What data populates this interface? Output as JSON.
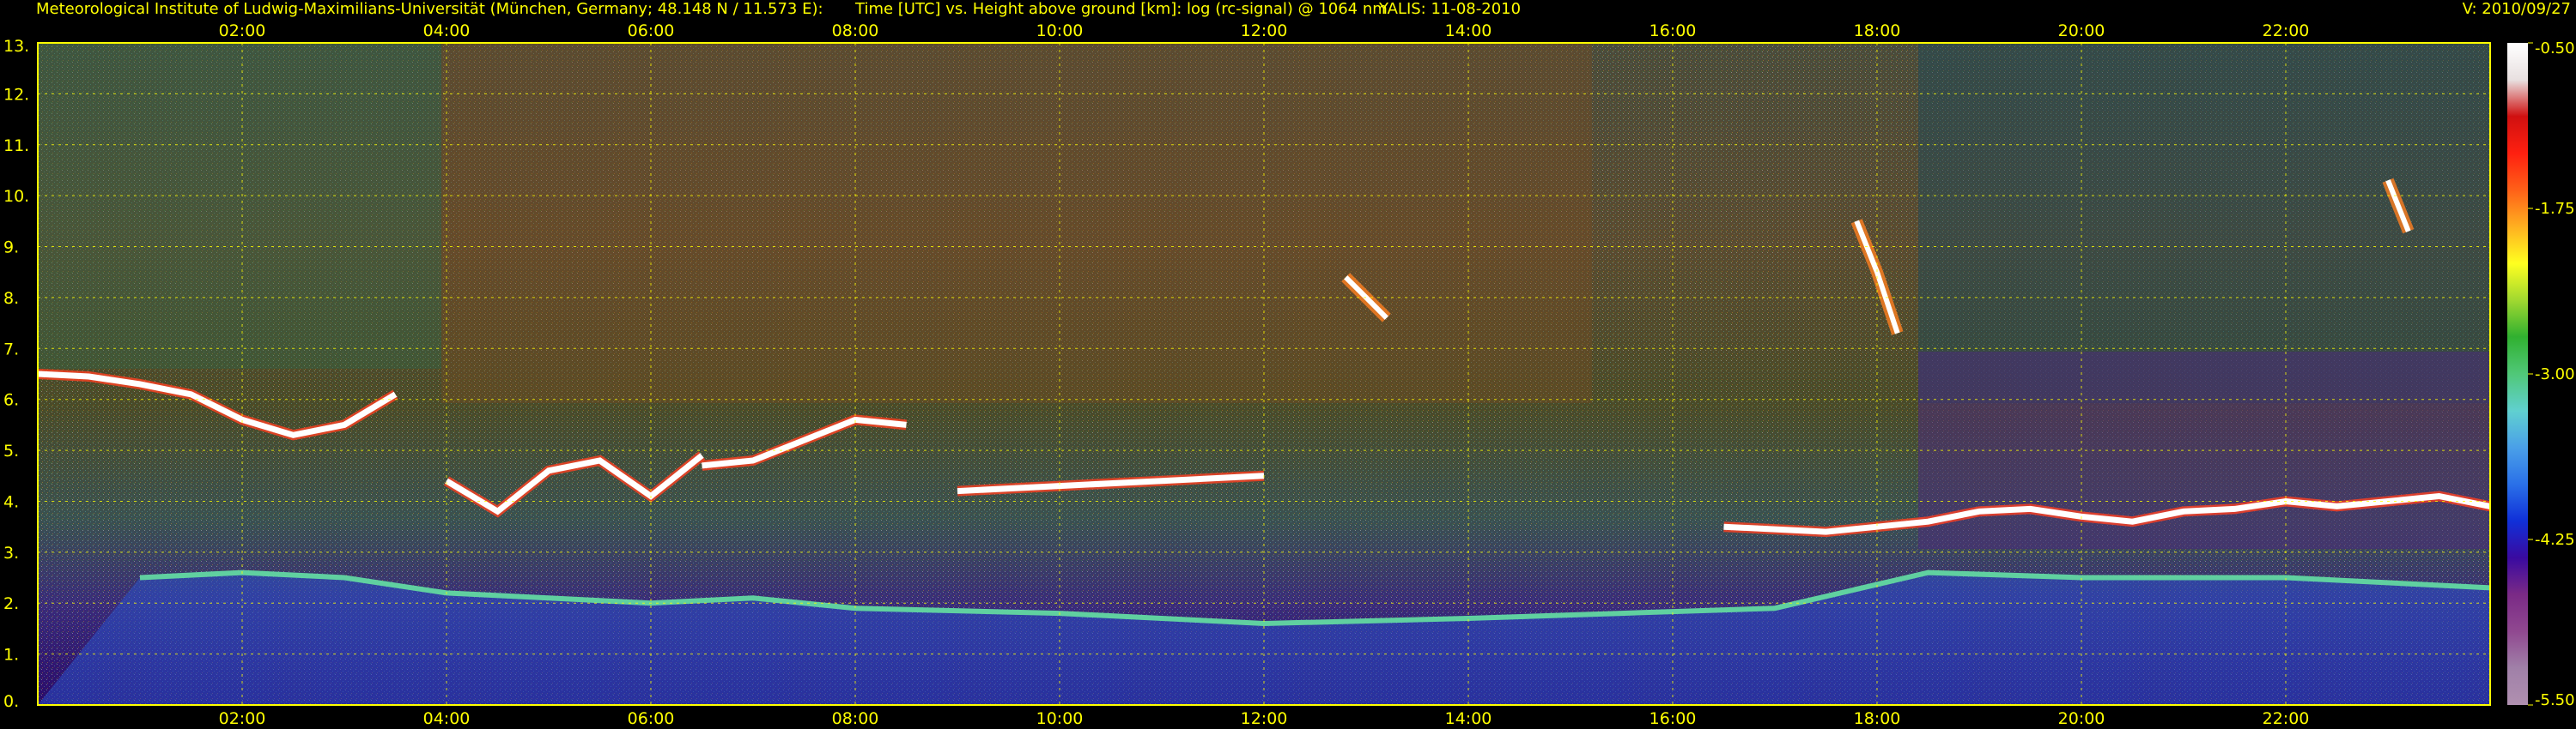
{
  "header": {
    "institute": "Meteorological Institute of Ludwig-Maximilians-Universität (München, Germany; 48.148 N / 11.573 E):",
    "axes": "Time [UTC] vs. Height above ground [km]: log (rc-signal) @ 1064 nm",
    "instrument": "YALIS: 11-08-2010",
    "version": "V: 2010/09/27"
  },
  "colors": {
    "text": "#ffff00",
    "grid": "#ffff00",
    "background": "#000000",
    "colorbar": [
      "#b090b0",
      "#a080a8",
      "#904890",
      "#7a2a86",
      "#3a0aa0",
      "#1030d8",
      "#2a70e8",
      "#4aa0e8",
      "#60d0d0",
      "#50c878",
      "#30b030",
      "#a0d830",
      "#ffff20",
      "#ffb020",
      "#ff6018",
      "#ff2010",
      "#d01010",
      "#e8e0e0",
      "#ffffff"
    ]
  },
  "chart_data": {
    "type": "heatmap",
    "title": "Time [UTC] vs. Height above ground [km]: log (rc-signal) @ 1064 nm",
    "xlabel": "Time [UTC]",
    "ylabel": "Height above ground [km]",
    "x_ticks": [
      "02:00",
      "04:00",
      "06:00",
      "08:00",
      "10:00",
      "12:00",
      "14:00",
      "16:00",
      "18:00",
      "20:00",
      "22:00"
    ],
    "x_tick_hours": [
      2,
      4,
      6,
      8,
      10,
      12,
      14,
      16,
      18,
      20,
      22
    ],
    "xlim_hours": [
      0,
      24
    ],
    "y_ticks": [
      "0.",
      "1.",
      "2.",
      "3.",
      "4.",
      "5.",
      "6.",
      "7.",
      "8.",
      "9.",
      "10.",
      "11.",
      "12.",
      "13."
    ],
    "y_tick_values": [
      0,
      1,
      2,
      3,
      4,
      5,
      6,
      7,
      8,
      9,
      10,
      11,
      12,
      13
    ],
    "ylim_km": [
      0,
      13
    ],
    "grid": true,
    "colorbar": {
      "ticks": [
        "-0.50",
        "-1.75",
        "-3.00",
        "-4.25",
        "-5.50"
      ],
      "tick_values": [
        -0.5,
        -1.75,
        -3.0,
        -4.25,
        -5.5
      ],
      "range": [
        -5.5,
        -0.5
      ]
    },
    "features": [
      {
        "name": "cloud layer",
        "t": [
          0.0,
          0.5,
          1.0,
          1.5,
          2.0,
          2.5,
          3.0,
          3.5
        ],
        "h": [
          6.5,
          6.45,
          6.3,
          6.1,
          5.6,
          5.3,
          5.5,
          6.1
        ]
      },
      {
        "name": "cloud layer",
        "t": [
          4.0,
          4.5,
          5.0,
          5.5,
          6.0,
          6.5
        ],
        "h": [
          4.4,
          3.8,
          4.6,
          4.8,
          4.1,
          4.9
        ]
      },
      {
        "name": "cloud layer",
        "t": [
          6.5,
          7.0,
          7.5,
          8.0,
          8.5
        ],
        "h": [
          4.7,
          4.8,
          5.2,
          5.6,
          5.5
        ]
      },
      {
        "name": "cloud layer",
        "t": [
          9.0,
          10.0,
          11.0,
          12.0
        ],
        "h": [
          4.2,
          4.3,
          4.4,
          4.5
        ]
      },
      {
        "name": "cloud layer",
        "t": [
          16.5,
          17.0,
          17.5,
          18.0,
          18.5,
          19.0,
          19.5,
          20.0,
          20.5,
          21.0,
          21.5,
          22.0,
          22.5,
          23.0,
          23.5,
          24.0
        ],
        "h": [
          3.5,
          3.45,
          3.4,
          3.5,
          3.6,
          3.8,
          3.85,
          3.7,
          3.6,
          3.8,
          3.85,
          4.0,
          3.9,
          4.0,
          4.1,
          3.9
        ]
      },
      {
        "name": "cirrus",
        "t": [
          12.8,
          13.0,
          13.2
        ],
        "h": [
          8.4,
          8.0,
          7.6
        ]
      },
      {
        "name": "cirrus",
        "t": [
          17.8,
          18.0,
          18.2
        ],
        "h": [
          9.5,
          8.5,
          7.3
        ]
      },
      {
        "name": "cirrus",
        "t": [
          23.0,
          23.2
        ],
        "h": [
          10.3,
          9.3
        ]
      },
      {
        "name": "boundary layer",
        "t": [
          1.0,
          2.0,
          3.0,
          4.0,
          5.0,
          6.0,
          7.0,
          8.0,
          10.0,
          12.0,
          14.0,
          15.5,
          17.0,
          18.5,
          20.0,
          22.0,
          24.0
        ],
        "h": [
          2.5,
          2.6,
          2.5,
          2.2,
          2.1,
          2.0,
          2.1,
          1.9,
          1.8,
          1.6,
          1.7,
          1.8,
          1.9,
          2.6,
          2.5,
          2.5,
          2.3
        ]
      }
    ]
  }
}
